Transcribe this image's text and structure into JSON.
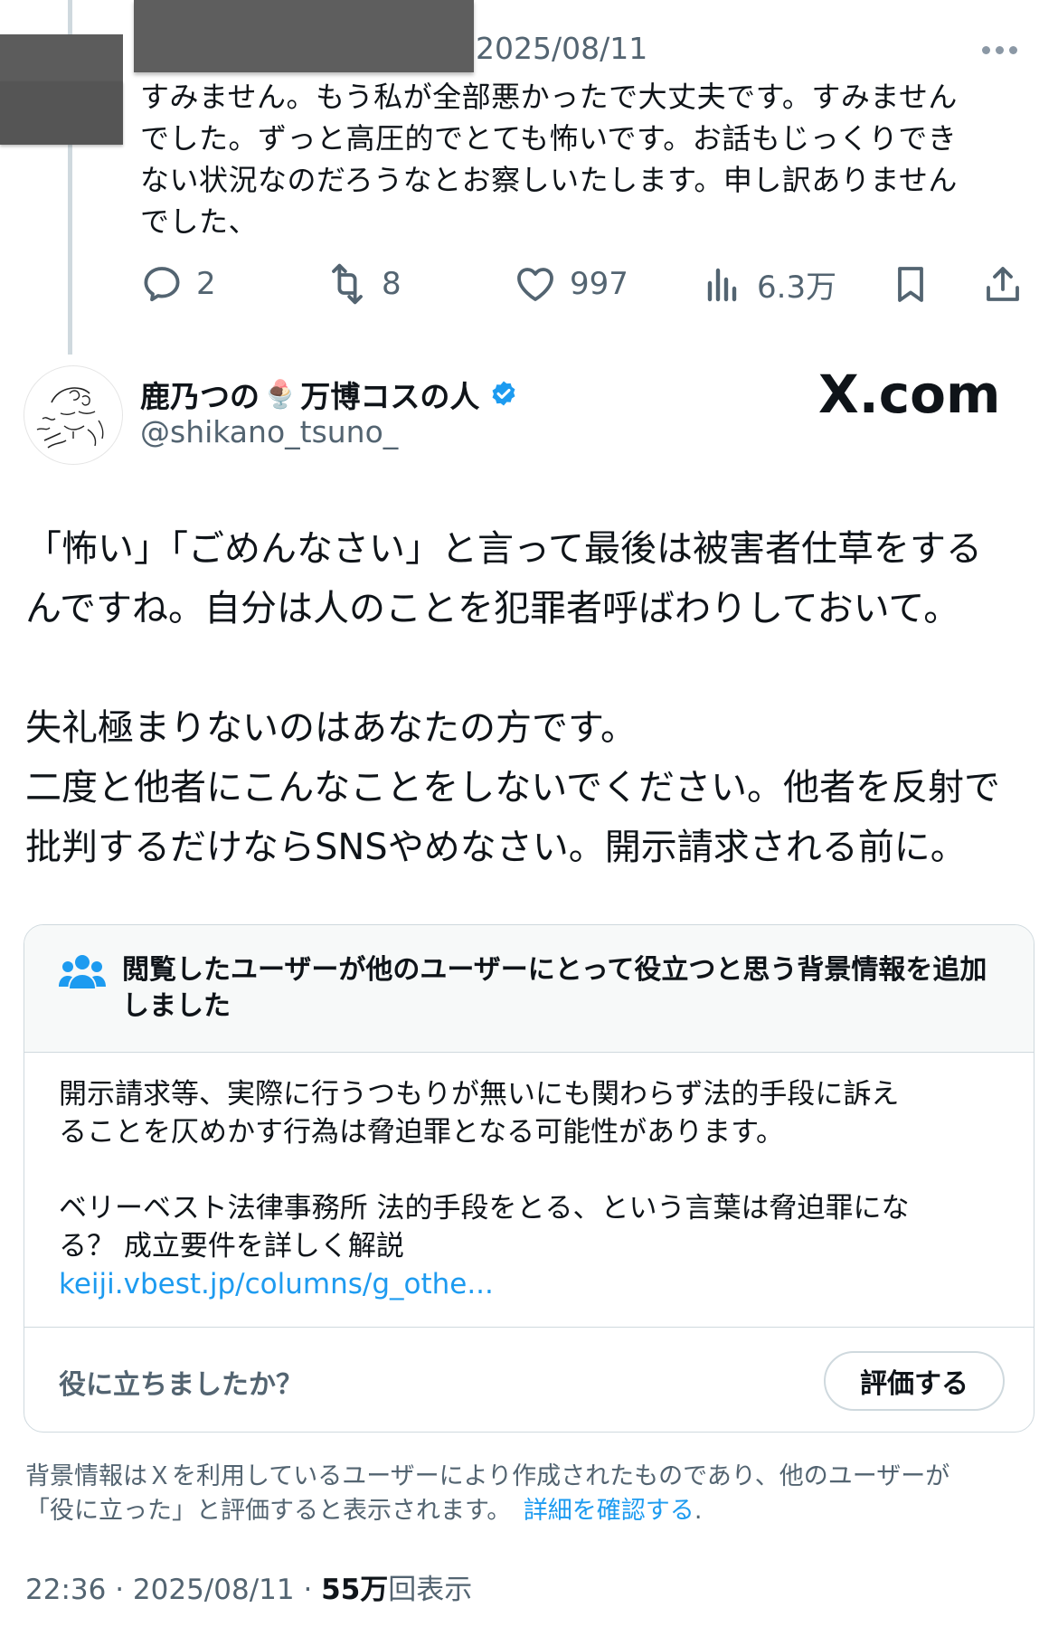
{
  "reply_tweet": {
    "date": "2025/08/11",
    "text_lines": [
      "すみません。もう私が全部悪かったで大丈夫です。すみません",
      "でした。ずっと高圧的でとても怖いです。お話もじっくりでき",
      "ない状況なのだろうなとお察しいたします。申し訳ありません",
      "でした、"
    ],
    "actions": {
      "replies": "2",
      "retweets": "8",
      "likes": "997",
      "views": "6.3万"
    }
  },
  "main_tweet": {
    "display_name_part1": "鹿乃つの",
    "display_name_emoji": "🍨",
    "display_name_part2": "万博コスの人",
    "handle": "@shikano_tsuno_",
    "body_lines": [
      "「怖い」「ごめんなさい」と言って最後は被害者仕草をする",
      "んですね。自分は人のことを犯罪者呼ばわりしておいて。",
      "",
      "失礼極まりないのはあなたの方です。",
      "二度と他者にこんなことをしないでください。他者を反射で",
      "批判するだけならSNSやめなさい。開示請求される前に。"
    ]
  },
  "watermark": "X.com",
  "community_note": {
    "header": "閲覧したユーザーが他のユーザーにとって役立つと思う背景情報を追加しました",
    "body_line1": "開示請求等、実際に行うつもりが無いにも関わらず法的手段に訴え",
    "body_line2": "ることを仄めかす行為は脅迫罪となる可能性があります。",
    "source_line1": "ベリーベスト法律事務所 法的手段をとる、という言葉は脅迫罪にな",
    "source_line2": "る？ 成立要件を詳しく解説",
    "link": "keiji.vbest.jp/columns/g_othe...",
    "helpful_question": "役に立ちましたか？",
    "rate_button": "評価する"
  },
  "disclaimer": {
    "line1": "背景情報はＸを利用しているユーザーにより作成されたものであり、他のユーザーが",
    "line2": "「役に立った」と評価すると表示されます。",
    "link": "詳細を確認する",
    "period": "."
  },
  "meta": {
    "time": "22:36",
    "sep1": " · ",
    "date": "2025/08/11",
    "sep2": " · ",
    "views_count": "55万",
    "views_label": "回表示"
  },
  "colors": {
    "accent": "#1d9bf0",
    "text_primary": "#0f1419",
    "text_secondary": "#536471",
    "border": "#cfd9de"
  }
}
